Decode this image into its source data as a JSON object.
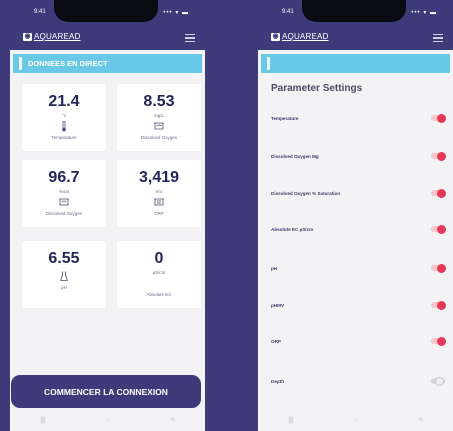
{
  "status_bar": {
    "time": "9:41",
    "signal": "••• ▾ ▬"
  },
  "app": {
    "name": "AQUAREAD"
  },
  "live_screen": {
    "section_title": "DONNEES EN DIRECT",
    "tiles": [
      {
        "value": "21.4",
        "unit": "°c",
        "icon": "thermometer-icon",
        "label": "Temperature"
      },
      {
        "value": "8.53",
        "unit": "mg/L",
        "icon": "oxygen-sensor-icon",
        "label": "Dissolved Oxygen"
      },
      {
        "value": "96.7",
        "unit": "%sat",
        "icon": "oxygen-sensor-icon",
        "label": "Dissolved Oxygen"
      },
      {
        "value": "3,419",
        "unit": "mV",
        "icon": "orp-sensor-icon",
        "label": "ORP"
      },
      {
        "value": "6.55",
        "unit": "",
        "icon": "ph-flask-icon",
        "label": "pH"
      },
      {
        "value": "0",
        "unit": "µS/cm",
        "icon": "",
        "label": "Absolute EC"
      }
    ],
    "connect_button": "COMMENCER LA CONNEXION"
  },
  "settings_screen": {
    "title": "Parameter Settings",
    "params": [
      {
        "name": "Temperature",
        "on": true
      },
      {
        "name": "Dissolved Oxygen Mg",
        "on": true
      },
      {
        "name": "Dissolved Oxygen % Saturation",
        "on": true
      },
      {
        "name": "Absolute EC µS/cm",
        "on": true
      },
      {
        "name": "pH",
        "on": true
      },
      {
        "name": "pHMV",
        "on": true
      },
      {
        "name": "ORP",
        "on": true
      },
      {
        "name": "Depth",
        "on": false
      }
    ]
  },
  "nav": {
    "recents": "|||",
    "home": "○",
    "back": "<"
  },
  "colors": {
    "brand": "#3d3b7a",
    "section": "#69c8e6",
    "toggle_on": "#e8385a",
    "background": "#f3f3f5"
  }
}
